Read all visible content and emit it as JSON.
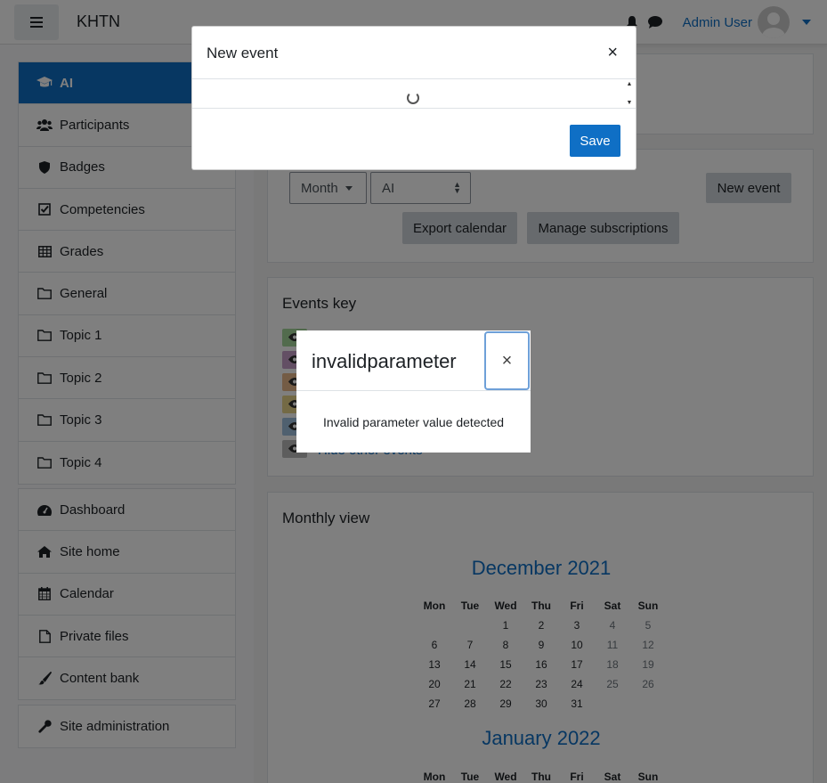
{
  "navbar": {
    "brand": "KHTN",
    "user_name": "Admin User"
  },
  "drawer": {
    "course_items": [
      {
        "label": "AI",
        "icon": "graduation-cap-icon",
        "active": true
      },
      {
        "label": "Participants",
        "icon": "users-icon"
      },
      {
        "label": "Badges",
        "icon": "shield-icon"
      },
      {
        "label": "Competencies",
        "icon": "check-square-icon"
      },
      {
        "label": "Grades",
        "icon": "table-icon"
      },
      {
        "label": "General",
        "icon": "folder-icon"
      },
      {
        "label": "Topic 1",
        "icon": "folder-icon"
      },
      {
        "label": "Topic 2",
        "icon": "folder-icon"
      },
      {
        "label": "Topic 3",
        "icon": "folder-icon"
      },
      {
        "label": "Topic 4",
        "icon": "folder-icon"
      }
    ],
    "site_items": [
      {
        "label": "Dashboard",
        "icon": "dashboard-icon"
      },
      {
        "label": "Site home",
        "icon": "home-icon"
      },
      {
        "label": "Calendar",
        "icon": "calendar-icon"
      },
      {
        "label": "Private files",
        "icon": "file-icon"
      },
      {
        "label": "Content bank",
        "icon": "paint-brush-icon"
      }
    ],
    "admin_items": [
      {
        "label": "Site administration",
        "icon": "wrench-icon"
      }
    ]
  },
  "calendar_controls": {
    "view_select": "Month",
    "course_select": "AI",
    "new_event": "New event",
    "export": "Export calendar",
    "manage": "Manage subscriptions"
  },
  "events_key": {
    "title": "Events key",
    "last_item": "Hide other events",
    "colors": [
      "#a4d69b",
      "#c79fc9",
      "#e8b98a",
      "#e9d48a",
      "#9fc0de",
      "#bbbbbb"
    ]
  },
  "monthly_view": {
    "title": "Monthly view",
    "weekdays": [
      "Mon",
      "Tue",
      "Wed",
      "Thu",
      "Fri",
      "Sat",
      "Sun"
    ],
    "months": [
      {
        "name": "December 2021",
        "weeks": [
          [
            "",
            "",
            "1",
            "2",
            "3",
            "4",
            "5"
          ],
          [
            "6",
            "7",
            "8",
            "9",
            "10",
            "11",
            "12"
          ],
          [
            "13",
            "14",
            "15",
            "16",
            "17",
            "18",
            "19"
          ],
          [
            "20",
            "21",
            "22",
            "23",
            "24",
            "25",
            "26"
          ],
          [
            "27",
            "28",
            "29",
            "30",
            "31",
            "",
            ""
          ]
        ]
      },
      {
        "name": "January 2022"
      }
    ]
  },
  "new_event_modal": {
    "title": "New event",
    "close": "×",
    "save": "Save"
  },
  "error_modal": {
    "title": "invalidparameter",
    "close": "×",
    "message": "Invalid parameter value detected"
  }
}
